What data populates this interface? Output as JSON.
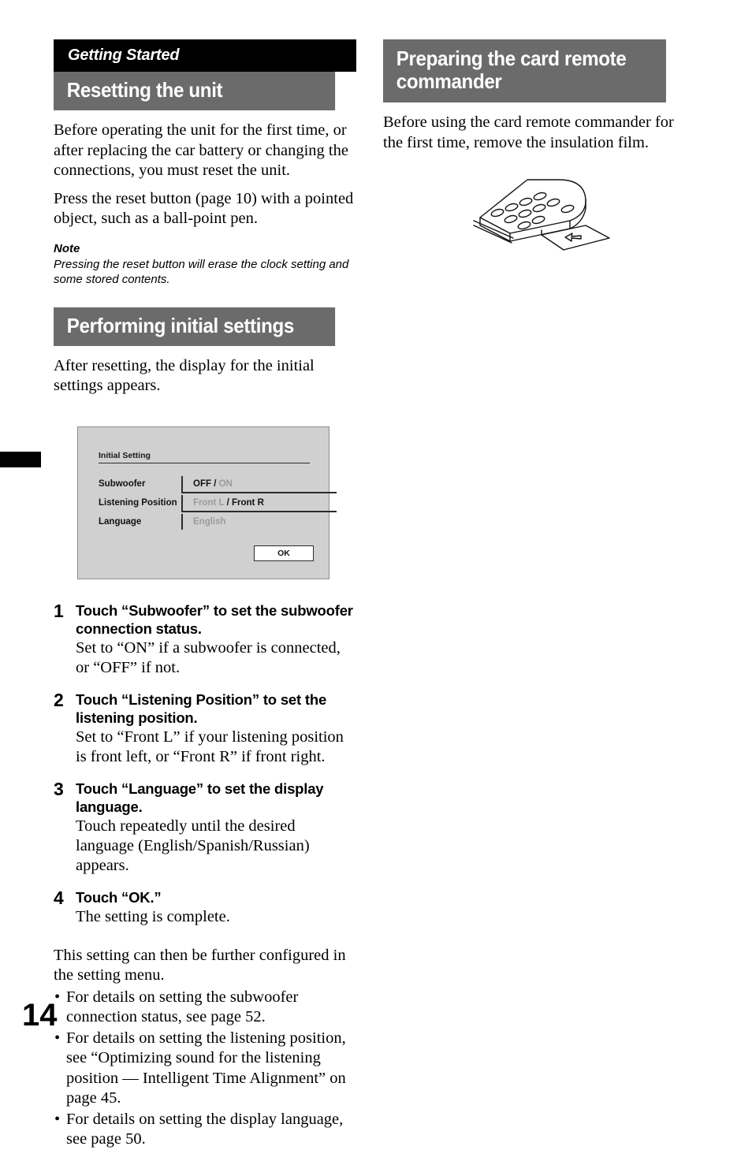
{
  "page": {
    "number": "14",
    "section_tab": "thumb-index-tab"
  },
  "left_column": {
    "section_label": "Getting Started",
    "section1": {
      "title": "Resetting the unit",
      "paragraphs": [
        "Before operating the unit for the first time, or after replacing the car battery or changing the connections, you must reset the unit.",
        "Press the reset button (page 10) with a pointed object, such as a ball-point pen."
      ],
      "note_title": "Note",
      "note_body": "Pressing the reset button will erase the clock setting and some stored contents."
    },
    "section2": {
      "title": "Performing initial settings",
      "intro": "After resetting, the display for the initial settings appears.",
      "screen": {
        "title": "Initial Setting",
        "rows": [
          {
            "label": "Subwoofer",
            "value_selected": "OFF",
            "separator": " / ",
            "value_other": "ON",
            "selected_first": true
          },
          {
            "label": "Listening Position",
            "value_selected": "Front R",
            "separator": " / ",
            "value_other": "Front L",
            "selected_first": false
          },
          {
            "label": "Language",
            "value_selected": "",
            "separator": "",
            "value_other": "English",
            "selected_first": false
          }
        ],
        "ok_label": "OK"
      },
      "steps": [
        {
          "number": "1",
          "heading": "Touch “Subwoofer” to set the subwoofer connection status.",
          "text": "Set to “ON” if a subwoofer is connected, or “OFF” if not."
        },
        {
          "number": "2",
          "heading": "Touch “Listening Position” to set the listening position.",
          "text": "Set to “Front L” if your listening position is front left, or “Front R” if front right."
        },
        {
          "number": "3",
          "heading": "Touch “Language” to set the display language.",
          "text": "Touch repeatedly until the desired language (English/Spanish/Russian) appears."
        },
        {
          "number": "4",
          "heading": "Touch “OK.”",
          "text": "The setting is complete."
        }
      ],
      "closing": "This setting can then be further configured in the setting menu.",
      "bullets": [
        "For details on setting the subwoofer connection status, see page 52.",
        "For details on setting the listening position, see “Optimizing sound for the listening position — Intelligent Time Alignment” on page 45.",
        "For details on setting the display language, see page 50."
      ],
      "bullet_marker": "•"
    }
  },
  "right_column": {
    "section1": {
      "title": "Preparing the card remote commander",
      "paragraph": "Before using the card remote commander for the first time, remove the insulation film.",
      "illustration": "card-remote-commander-insulation-film-diagram"
    }
  }
}
